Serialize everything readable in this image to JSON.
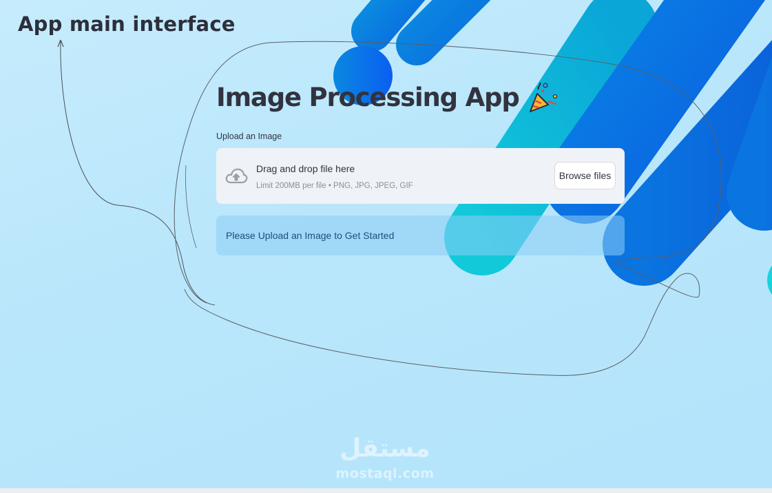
{
  "annotation": {
    "title": "App main interface"
  },
  "app": {
    "title": "Image Processing App",
    "title_emoji_icon": "party-popper-icon"
  },
  "uploader": {
    "label": "Upload an Image",
    "instruction": "Drag and drop file here",
    "limit_text": "Limit 200MB per file • PNG, JPG, JPEG, GIF",
    "browse_label": "Browse files",
    "icon": "cloud-upload-icon"
  },
  "info": {
    "message": "Please Upload an Image to Get Started"
  },
  "watermark": {
    "logo_text": "مستقل",
    "url": "mostaql.com"
  },
  "colors": {
    "background": "#bde8fc",
    "shape_dark_blue": "#0a6fe0",
    "shape_cyan": "#16c3d6",
    "dropzone": "#eff2f6",
    "info_box": "#9fd6f7",
    "title_text": "#31333f"
  }
}
